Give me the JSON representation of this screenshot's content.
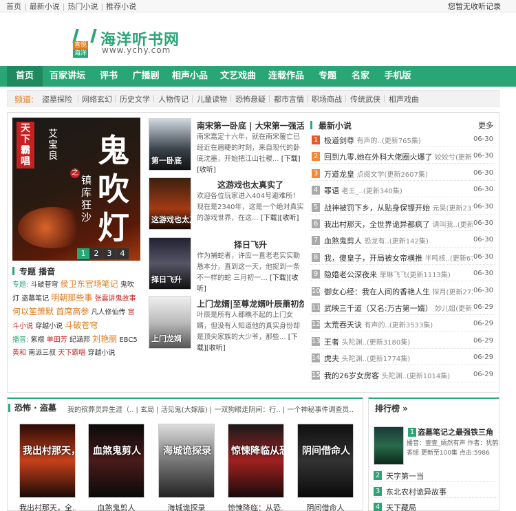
{
  "topbar": {
    "links": [
      "首页",
      "最新小说",
      "热门小说",
      "推荐小说"
    ],
    "right": "您暂无收听记录"
  },
  "logo": {
    "badge_top": "喜悦",
    "badge_bottom": "海洋",
    "name": "海洋听书网",
    "url": "www.ychy.com"
  },
  "nav": {
    "items": [
      "首页",
      "百家讲坛",
      "评书",
      "广播剧",
      "相声小品",
      "文艺戏曲",
      "连载作品",
      "专题",
      "名家",
      "手机版"
    ],
    "active": "首页"
  },
  "channels": {
    "label": "频道:",
    "items": [
      "盗墓探险",
      "网络玄幻",
      "历史文学",
      "人物传记",
      "儿童读物",
      "恐怖悬疑",
      "都市言情",
      "职场商战",
      "传统武侠",
      "相声戏曲"
    ]
  },
  "carousel": {
    "cover_text_1": "天下霸唱",
    "cover_text_2": "艾宝良",
    "cover_text_3": "鬼吹灯",
    "cover_text_4": "镇库狂沙",
    "cover_text_5": "之",
    "pages": [
      "1",
      "2",
      "3",
      "4",
      "5"
    ]
  },
  "topic": {
    "title": "专题 播音",
    "zt_label": "专题:",
    "zt_items": [
      "斗破苍穹",
      "侯卫东官场笔记",
      "鬼吹灯",
      "盗墓笔记",
      "明朝那些事",
      "张震讲鬼故事",
      "何以笙箫默",
      "首席高参",
      "凡人修仙传",
      "宫斗小说",
      "穿越小说",
      "斗破苍穹"
    ],
    "by_label": "播音:",
    "by_items": [
      "紫襟",
      "单田芳",
      "纪涵邦",
      "刘艳丽",
      "EBC5",
      "黄和",
      "南派三叔",
      "天下霸唱",
      "穿越小说"
    ]
  },
  "featured": [
    {
      "title": "南宋第一卧底 | 大宋第一强活",
      "desc": "南宋嘉定十六年，就在南宋覆亡已经近在眉睫的时刻，来自现代的卧底沈墨，开始把江山社稷...",
      "cover": "第一卧底",
      "dl": "[下载]",
      "fav": "[收听]"
    },
    {
      "title": "这游戏也太真实了",
      "desc": "欢迎各位玩家进入404号避难所！现在是2340年，这是一个绝对真实的游戏世界，在这...",
      "cover": "这游戏也太真实了",
      "dl": "[下载]",
      "fav": "[收听]"
    },
    {
      "title": "择日飞升",
      "desc": "作为捕蛇者，许应一直老老实实勤恳本分，直到这一天，他捉到一条不一样的蛇 三月初一...",
      "cover": "择日飞升",
      "dl": "[下载]",
      "fav": "[收听]"
    },
    {
      "title": "上门龙婿|至尊龙婿叶辰萧初然",
      "desc": "叶辰是所有人都瞧不起的上门女婿，但没有人知道他的真实身份却是顶尖家族的大少爷，那些...",
      "cover": "上门龙婿",
      "dl": "[下载]",
      "fav": "[收听]"
    }
  ],
  "newlist": {
    "title": "最新小说",
    "more": "更多",
    "rows": [
      {
        "num": "1",
        "name": "极道剑尊",
        "meta": "有声的..(更新765集)",
        "date": "06-30"
      },
      {
        "num": "2",
        "name": "回到九零,她在外科大佬圈火爆了",
        "meta": "姣姣兮(更新727集)",
        "date": "06-30"
      },
      {
        "num": "3",
        "name": "万道龙皇",
        "meta": "点阅文学(更新2607集)",
        "date": "06-30"
      },
      {
        "num": "4",
        "name": "罪语",
        "meta": "老王_..(更新340集)",
        "date": "06-30"
      },
      {
        "num": "5",
        "name": "战神被罚下乡，从贴身保镖开始",
        "meta": "元昊(更新2315集)",
        "date": "06-30"
      },
      {
        "num": "6",
        "name": "我出村那天，全世界诡异都疯了",
        "meta": "请叫我..(更新313集)",
        "date": "06-30"
      },
      {
        "num": "7",
        "name": "血煞鬼剪人",
        "meta": "恐龙有..(更新142集)",
        "date": "06-30"
      },
      {
        "num": "8",
        "name": "我，傻皇子，开局被女帝横推",
        "meta": "半吨核..(更新670集)",
        "date": "06-30"
      },
      {
        "num": "9",
        "name": "隐婚老公深夜来",
        "meta": "菲琳飞飞(更新1113集)",
        "date": "06-30"
      },
      {
        "num": "10",
        "name": "御女心经：我在人间的香艳人生",
        "meta": "探月(更新2726集)",
        "date": "06-30"
      },
      {
        "num": "11",
        "name": "武映三千道（又名:万古第一婿）",
        "meta": "妙儿姐(更新2554集)",
        "date": "06-29"
      },
      {
        "num": "12",
        "name": "太荒吞天诀",
        "meta": "有声的..(更新3533集)",
        "date": "06-29"
      },
      {
        "num": "13",
        "name": "王者",
        "meta": "头陀渊..(更新3180集)",
        "date": "06-29"
      },
      {
        "num": "14",
        "name": "虎夫",
        "meta": "头陀渊..(更新1774集)",
        "date": "06-29"
      },
      {
        "num": "15",
        "name": "我的26岁女房客",
        "meta": "头陀渊..(更新1014集)",
        "date": "06-29"
      }
    ]
  },
  "section": {
    "title": "恐怖 · 盗墓",
    "links": "我的殡葬灵异生涯（..  |  玄局  |  活见鬼(大嫁版)  |  一双狗眼走阴间：行..  |  一个神秘事件调查员..",
    "books": [
      {
        "cover": "我出村那天，全世界诡异都疯了",
        "caption": "我出村那天，全..."
      },
      {
        "cover": "血煞鬼剪人",
        "caption": "血煞鬼剪人"
      },
      {
        "cover": "海城诡探录",
        "caption": "海城诡探录"
      },
      {
        "cover": "惊悚降临从恐怖旅馆开始",
        "caption": "惊悚降临：从恐..."
      },
      {
        "cover": "阴间借命人",
        "caption": "阴间借命人"
      }
    ]
  },
  "rank": {
    "title": "排行榜 »",
    "top": {
      "num": "1",
      "name": "盗墓笔记之最强铁三角",
      "info": "播音：壹壹_嫣然有声 作者：犹鹤香瑶 更新至100集 点击:5986"
    },
    "rows": [
      {
        "num": "2",
        "name": "天字第一当"
      },
      {
        "num": "3",
        "name": "东北农村诡异故事"
      },
      {
        "num": "4",
        "name": "天下藏局"
      }
    ]
  },
  "colors": {
    "accent": "#2aa676",
    "orange": "#e07a18",
    "red": "#c62020"
  }
}
